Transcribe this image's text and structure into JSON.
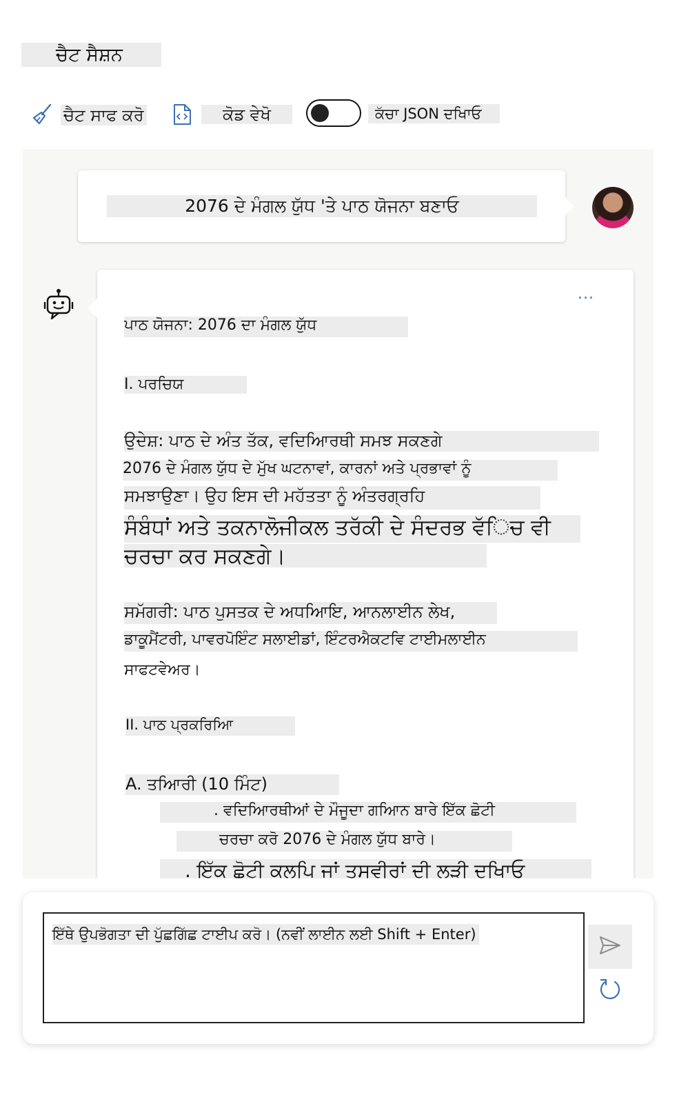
{
  "header": {
    "title": "ਚੈਟ ਸੈਸ਼ਨ"
  },
  "toolbar": {
    "clear_label": "ਚੈਟ ਸਾਫ ਕਰੋ",
    "code_label": "ਕੋਡ ਵੇਖੋ",
    "json_label": "ਕੱਚਾ JSON ਦਖਿਾਓ",
    "json_toggle_on": false
  },
  "conversation": {
    "user_message": "2076 ਦੇ ਮੰਗਲ ਯੁੱਧ 'ਤੇ ਪਾਠ ਯੋਜਨਾ ਬਣਾਓ",
    "more_label": "...",
    "assistant_lines": [
      "ਪਾਠ ਯੋਜਨਾ: 2076 ਦਾ ਮੰਗਲ ਯੁੱਧ",
      "I. ਪਰਚਿਯ",
      "ਉਦੇਸ਼: ਪਾਠ ਦੇ ਅੰਤ ਤੱਕ, ਵਦਿਆਿਰਥੀ ਸਮਝ ਸਕਣਗੇ",
      "2076 ਦੇ ਮੰਗਲ ਯੁੱਧ ਦੇ ਮੁੱਖ ਘਟਨਾਵਾਂ, ਕਾਰਨਾਂ ਅਤੇ ਪ੍ਰਭਾਵਾਂ ਨੂੰ",
      "ਸਮਝਾਉਣਾ। ਉਹ ਇਸ ਦੀ ਮਹੱਤਤਾ ਨੂੰ ਅੰਤਰਗ੍ਰਹਿ",
      "ਸੰਬੰਧਾਂ ਅਤੇ ਤਕਨਾਲੋਜੀਕਲ ਤਰੱਕੀ ਦੇ ਸੰਦਰਭ ਵੱਿਚ ਵੀ",
      "ਚਰਚਾ ਕਰ ਸਕਣਗੇ।",
      "ਸਮੱਗਰੀ: ਪਾਠ ਪੁਸਤਕ ਦੇ ਅਧਆਿਇ, ਆਨਲਾਈਨ ਲੇਖ,",
      "ਡਾਕੂਮੈਂਟਰੀ, ਪਾਵਰਪੋਇੰਟ ਸਲਾਈਡਾਂ, ਇੰਟਰਐਕਟਵਿ ਟਾਈਮਲਾਈਨ",
      "ਸਾਫਟਵੇਅਰ।",
      "II. ਪਾਠ ਪ੍ਰਕਰਿਆਿ",
      "A. ਤਆਿਰੀ (10 ਮਿੰਟ)",
      ". ਵਦਿਆਿਰਥੀਆਂ ਦੇ ਮੌਜੂਦਾ ਗਆਿਨ ਬਾਰੇ ਇੱਕ ਛੋਟੀ",
      "ਚਰਚਾ ਕਰੋ 2076 ਦੇ ਮੰਗਲ ਯੁੱਧ ਬਾਰੇ।",
      ". ਇੱਕ ਛੋਟੀ ਕਲਪਿ ਜਾਂ ਤਸਵੀਰਾਂ ਦੀ ਲੜੀ ਦਖਿਾਓ"
    ]
  },
  "input": {
    "placeholder": "ਇੱਥੇ ਉਪਭੋਗਤਾ ਦੀ ਪੁੱਛਗਿੱਛ ਟਾਈਪ ਕਰੋ। (ਨਵੀਂ ਲਾਈਨ ਲਈ Shift + Enter)"
  },
  "icons": {
    "clear": "broom-icon",
    "code": "code-file-icon",
    "assistant": "bot-icon",
    "send": "send-icon",
    "refresh": "refresh-icon"
  },
  "colors": {
    "accent": "#3c6fb4",
    "highlight": "#ececec",
    "chat_background": "#f7f7f6"
  }
}
